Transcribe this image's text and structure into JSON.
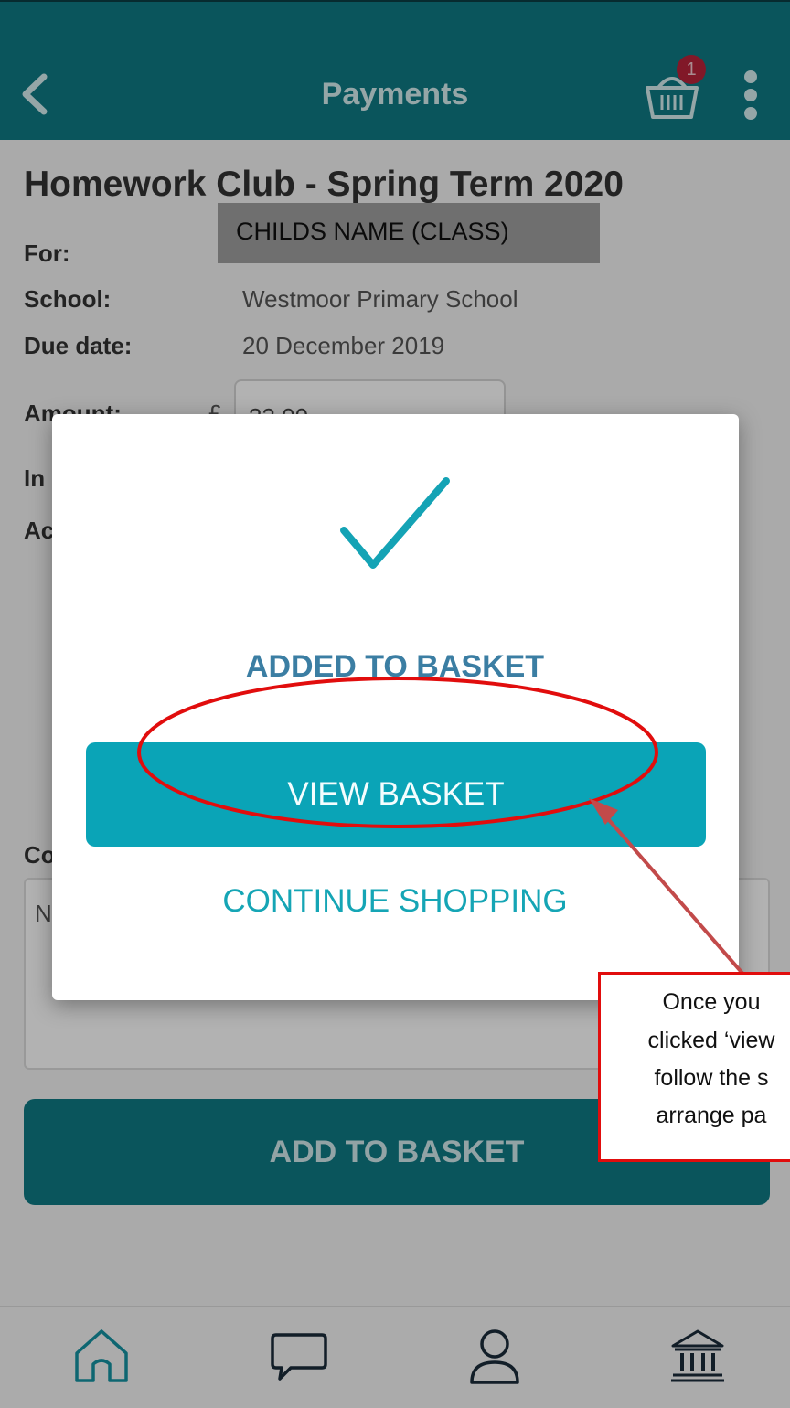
{
  "header": {
    "title": "Payments",
    "basket_count": "1"
  },
  "payment": {
    "title": "Homework Club - Spring Term 2020",
    "child_name": "CHILDS NAME (CLASS)",
    "for_label": "For:",
    "school_label": "School:",
    "school_value": "Westmoor Primary School",
    "due_label": "Due date:",
    "due_value": "20 December 2019",
    "amount_label": "Amount:",
    "currency": "£",
    "amount_value": "33.00",
    "instalment_label_partial": "In",
    "additional_label_partial": "Ac",
    "comments_label_partial": "Co",
    "comments_text_partial": "N",
    "add_button": "ADD TO BASKET"
  },
  "modal": {
    "status": "ADDED TO BASKET",
    "view_basket": "VIEW BASKET",
    "continue_shopping": "CONTINUE SHOPPING"
  },
  "annotation": {
    "lines": [
      "Once you",
      "clicked ‘view",
      "follow the s",
      "arrange pa"
    ],
    "color": "#e10d0d"
  },
  "nav": {
    "items": [
      "home-icon",
      "messages-icon",
      "profile-icon",
      "bank-icon"
    ]
  },
  "colors": {
    "header": "#0f7a85",
    "accent": "#0aa4b7",
    "badge": "#b9233a"
  }
}
